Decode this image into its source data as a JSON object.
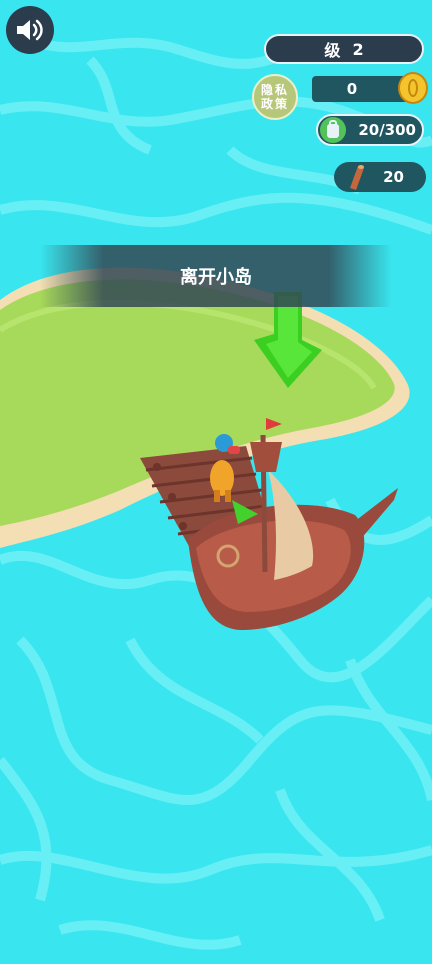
{
  "level": {
    "label": "级",
    "value": "2"
  },
  "privacy": {
    "line1": "隐私",
    "line2": "政策"
  },
  "coins": "0",
  "backpack": "20/300",
  "wood": "20",
  "banner": "离开小岛",
  "icons": {
    "sound": "speaker-icon",
    "coin": "gold-coin-icon",
    "backpack": "backpack-icon",
    "wood": "wood-log-icon",
    "arrow": "down-arrow-icon"
  },
  "colors": {
    "water": "#39e6ef",
    "island": "#a7d95a",
    "hud_dark": "#2b3c4d",
    "arrow": "#43d22c",
    "ship": "#9a4a3c"
  }
}
